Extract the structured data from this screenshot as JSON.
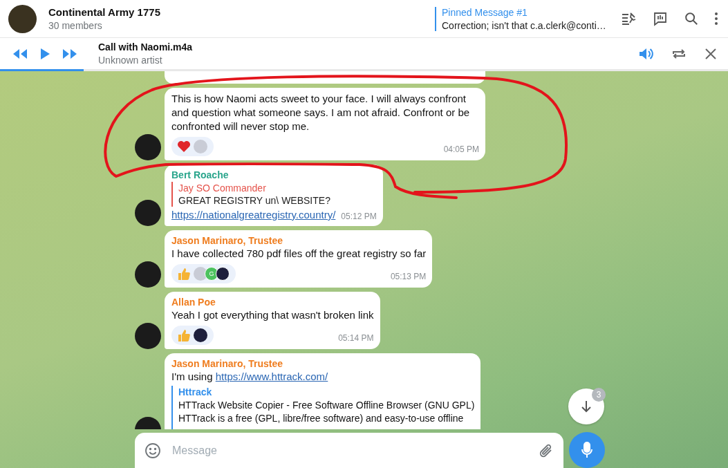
{
  "chat": {
    "title": "Continental Army 1775",
    "subtitle": "30 members"
  },
  "pinned": {
    "label": "Pinned Message #1",
    "text": "Correction; isn't that c.a.clerk@conti…"
  },
  "player": {
    "title": "Call with Naomi.m4a",
    "artist": "Unknown artist",
    "level": 0.115
  },
  "messages": [
    {
      "kind": "stub"
    },
    {
      "kind": "text",
      "text": "This is how Naomi acts sweet to your face. I will always confront and question what someone says. I am not afraid. Confront or be confronted will never stop me.",
      "reactions": [
        {
          "kind": "heart"
        },
        {
          "kind": "avatar",
          "color": "#c9ccd6"
        }
      ],
      "time": "04:05 PM"
    },
    {
      "kind": "text",
      "sender": "Bert Roache",
      "color": "#2aa58c",
      "reply": {
        "author": "Jay SO Commander",
        "text": "GREAT REGISTRY un\\ WEBSITE?"
      },
      "link": "https://nationalgreatregistry.country/",
      "time": "05:12 PM"
    },
    {
      "kind": "text",
      "sender": "Jason Marinaro, Trustee",
      "color": "#ef7d1f",
      "text": "I have collected 780 pdf files off the great registry so far",
      "reactions": [
        {
          "kind": "thumbs-up"
        },
        {
          "kind": "avatar",
          "color": "#c9ccd6"
        },
        {
          "kind": "avatar",
          "color": "#4cc25e",
          "text": "G"
        },
        {
          "kind": "avatar",
          "color": "#1d1f3c"
        }
      ],
      "time": "05:13 PM"
    },
    {
      "kind": "text",
      "sender": "Allan Poe",
      "color": "#ef7d1f",
      "text": "Yeah I got everything that wasn't broken link",
      "reactions": [
        {
          "kind": "thumbs-up"
        },
        {
          "kind": "avatar",
          "color": "#1d1f3c"
        }
      ],
      "time": "05:14 PM"
    },
    {
      "kind": "text",
      "sender": "Jason Marinaro, Trustee",
      "color": "#ef7d1f",
      "text": "I'm using ",
      "link": "https://www.httrack.com/",
      "preview": {
        "site": "Httrack",
        "title": "HTTrack Website Copier - Free Software Offline Browser (GNU GPL)",
        "description": "HTTrack is a free (GPL, libre/free software) and easy-to-use offline"
      }
    }
  ],
  "composer": {
    "placeholder": "Message"
  },
  "scroll_down": {
    "badge": "3"
  }
}
